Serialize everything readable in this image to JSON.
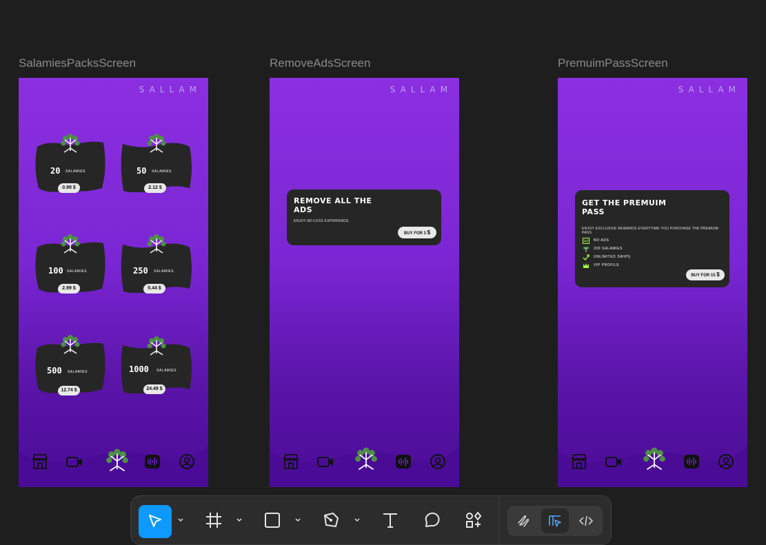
{
  "frames": {
    "salamies": {
      "label": "SalamiesPacksScreen",
      "brand": "SALLAM",
      "packs": [
        {
          "count": "20",
          "unit": "SALAMIES",
          "price": "0.99 $"
        },
        {
          "count": "50",
          "unit": "SALAMIES",
          "price": "2.12 $"
        },
        {
          "count": "100",
          "unit": "SALAMIES",
          "price": "2.99 $"
        },
        {
          "count": "250",
          "unit": "SALAMIES",
          "price": "5.44 $"
        },
        {
          "count": "500",
          "unit": "SALAMIES",
          "price": "12.74 $"
        },
        {
          "count": "1000",
          "unit": "SALAMIES",
          "price": "24.49 $"
        }
      ]
    },
    "remove_ads": {
      "label": "RemoveAdsScreen",
      "brand": "SALLAM",
      "title_line1": "REMOVE ALL THE",
      "title_line2": "ADS",
      "subtitle": "ENJOY AD-LESS EXPERIENCE",
      "buy_prefix": "BUY FOR 3",
      "buy_currency": "$"
    },
    "premium_pass": {
      "label": "PremuimPassScreen",
      "brand": "SALLAM",
      "title_line1": "GET THE PREMUIM",
      "title_line2": "PASS",
      "subtitle": "ENJOY EXCLUSIVE REWARDS EVERYTIME YOU PURCHASE THE PREMUIM PASS",
      "features": [
        {
          "icon": "ad-icon",
          "text": "NO ADS"
        },
        {
          "icon": "salami-icon",
          "text": "200 SALAMIES"
        },
        {
          "icon": "swipe-icon",
          "text": "UNLIMITED SWIPS"
        },
        {
          "icon": "crown-icon",
          "text": "VIP PROFILE"
        }
      ],
      "buy_prefix": "BUY FOR 15",
      "buy_currency": "$"
    }
  },
  "nav_icons": [
    "store-icon",
    "video-icon",
    "tree-logo-icon",
    "audio-icon",
    "profile-icon"
  ],
  "toolbar": {
    "tools": [
      "move-tool",
      "frame-tool",
      "shape-tool",
      "pen-tool",
      "text-tool",
      "comment-tool",
      "assets-tool"
    ],
    "modes": [
      "draw-mode",
      "design-mode",
      "dev-mode"
    ],
    "active_tool": "move-tool",
    "active_mode": "design-mode"
  },
  "colors": {
    "canvas": "#1e1e1e",
    "frame_top": "#8b2fe0",
    "frame_bottom": "#4a0c96",
    "card": "#262626",
    "accent": "#0d99ff",
    "leaf_green": "#4f8f47",
    "feature_green": "#a6ff4d"
  }
}
